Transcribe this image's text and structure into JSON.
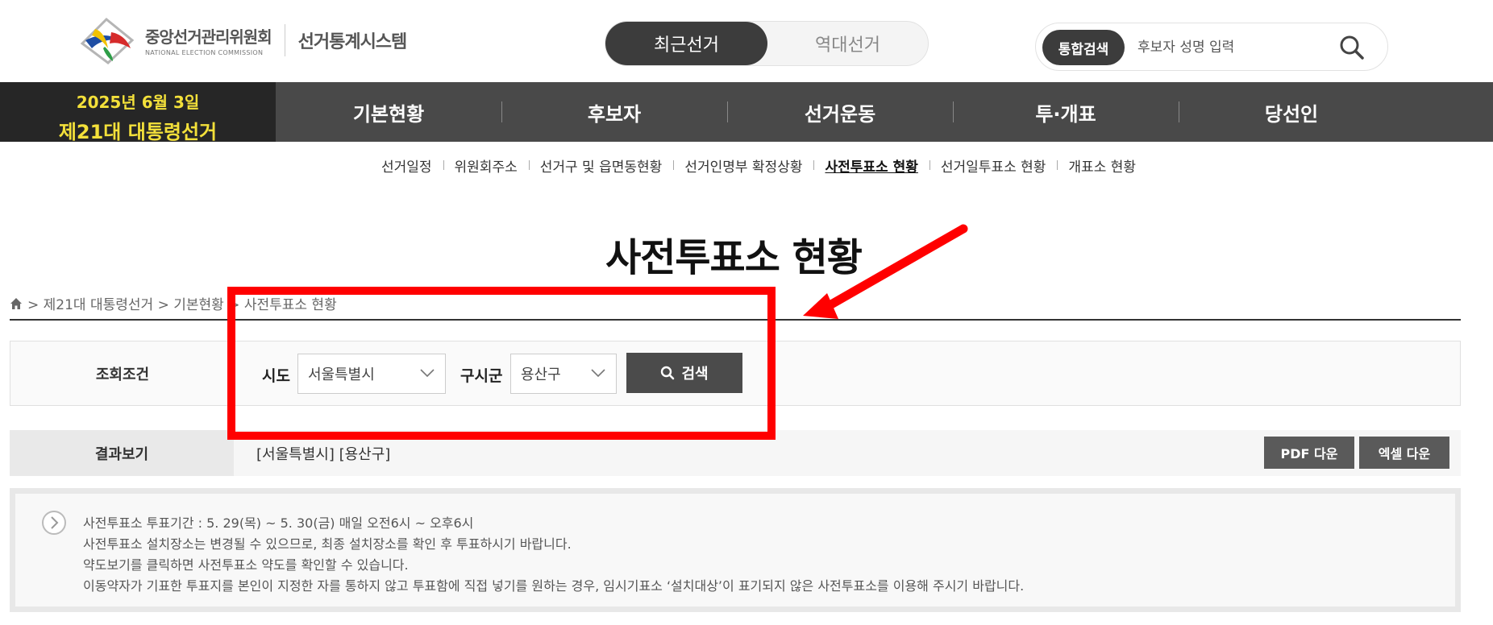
{
  "header": {
    "logo_kr": "중앙선거관리위원회",
    "logo_en": "NATIONAL ELECTION COMMISSION",
    "system_name": "선거통계시스템",
    "toggle": {
      "active": "최근선거",
      "inactive": "역대선거"
    },
    "search": {
      "tag": "통합검색",
      "placeholder": "후보자 성명 입력",
      "icon": "search-icon"
    }
  },
  "nav": {
    "election_date": "2025년 6월 3일",
    "election_title": "제21대 대통령선거",
    "items": [
      "기본현황",
      "후보자",
      "선거운동",
      "투·개표",
      "당선인"
    ]
  },
  "subnav": {
    "items": [
      "선거일정",
      "위원회주소",
      "선거구 및 읍면동현황",
      "선거인명부 확정상황",
      "사전투표소 현황",
      "선거일투표소 현황",
      "개표소 현황"
    ],
    "active": "사전투표소 현황"
  },
  "page": {
    "title": "사전투표소 현황",
    "breadcrumb": "> 제21대 대통령선거 > 기본현황 > 사전투표소 현황"
  },
  "query": {
    "label": "조회조건",
    "sido_label": "시도",
    "sido_value": "서울특별시",
    "sigungu_label": "구시군",
    "sigungu_value": "용산구",
    "search_button": "검색"
  },
  "result": {
    "label": "결과보기",
    "text": "[서울특별시] [용산구]",
    "pdf_button": "PDF 다운",
    "excel_button": "엑셀 다운"
  },
  "info": {
    "lines": [
      "사전투표소 투표기간 : 5. 29(목) ~ 5. 30(금) 매일 오전6시 ~ 오후6시",
      "사전투표소 설치장소는 변경될 수 있으므로, 최종 설치장소를 확인 후 투표하시기 바랍니다.",
      "약도보기를 클릭하면 사전투표소 약도를 확인할 수 있습니다.",
      "이동약자가 기표한 투표지를 본인이 지정한 자를 통하지 않고 투표함에 직접 넣기를 원하는 경우, 임시기표소 ‘설치대상’이 표기되지 않은 사전투표소를 이용해 주시기 바랍니다."
    ]
  },
  "colors": {
    "nav_bg": "#494949",
    "election_badge_text": "#f3e03a",
    "annotation": "#ff0000"
  }
}
